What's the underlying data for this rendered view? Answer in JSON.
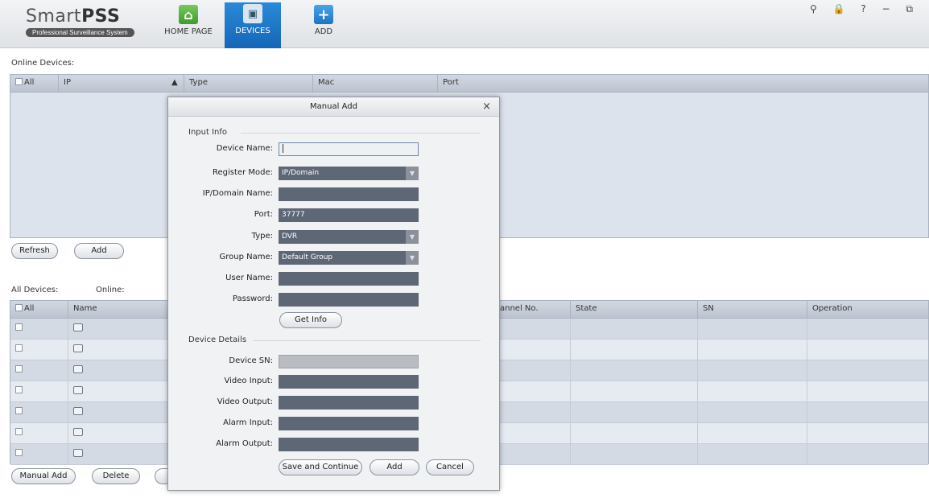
{
  "app": {
    "brand_prefix": "Smart",
    "brand_bold": "PSS",
    "subtitle": "Professional Surveillance System",
    "window_controls": "⚲ 🔒 ? − ⧉"
  },
  "nav": [
    {
      "label": "HOME PAGE",
      "icon": "home-icon"
    },
    {
      "label": "DEVICES",
      "icon": "devices-icon"
    },
    {
      "label": "ADD",
      "icon": "add-icon"
    }
  ],
  "online": {
    "title": "Online Devices:",
    "headers": [
      "All",
      "IP",
      "▲",
      "Type",
      "Mac",
      "Port"
    ],
    "refresh": "Refresh",
    "add": "Add"
  },
  "all_devices": {
    "title": "All Devices:",
    "online_label": "Online:",
    "headers": [
      "All",
      "Name",
      "annel No.",
      "State",
      "SN",
      "Operation"
    ],
    "manual_add": "Manual Add",
    "delete": "Delete"
  },
  "modal": {
    "title": "Manual Add",
    "close": "×",
    "input_info": "Input Info",
    "device_details": "Device Details",
    "labels": {
      "device_name": "Device Name:",
      "register_mode": "Register Mode:",
      "ip_domain": "IP/Domain Name:",
      "port": "Port:",
      "type": "Type:",
      "group_name": "Group Name:",
      "user_name": "User Name:",
      "password": "Password:",
      "device_sn": "Device SN:",
      "video_input": "Video Input:",
      "video_output": "Video Output:",
      "alarm_input": "Alarm Input:",
      "alarm_output": "Alarm Output:"
    },
    "values": {
      "register_mode": "IP/Domain",
      "port": "37777",
      "type": "DVR",
      "group_name": "Default Group"
    },
    "buttons": {
      "get_info": "Get Info",
      "save_continue": "Save and Continue",
      "add": "Add",
      "cancel": "Cancel"
    }
  }
}
